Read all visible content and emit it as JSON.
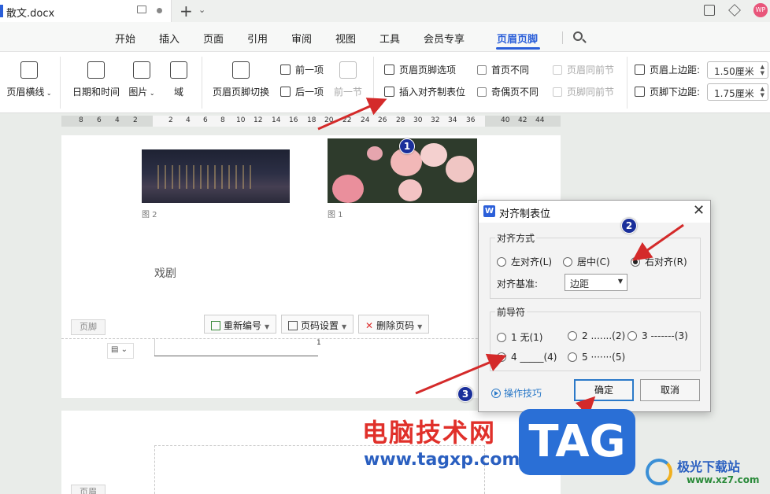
{
  "titlebar": {
    "doc_title": "散文.docx",
    "avatar_text": "WP"
  },
  "menu": {
    "items": [
      "开始",
      "插入",
      "页面",
      "引用",
      "审阅",
      "视图",
      "工具",
      "会员专享",
      "页眉页脚"
    ],
    "active": "页眉页脚"
  },
  "ribbon": {
    "header_line": "页眉横线",
    "date_time": "日期和时间",
    "picture": "图片",
    "field": "域",
    "switch_header_footer": "页眉页脚切换",
    "prev_item": "前一项",
    "next_item": "后一项",
    "prev_section": "前一节",
    "hf_options": "页眉页脚选项",
    "insert_tab": "插入对齐制表位",
    "first_diff": "首页不同",
    "odd_even_diff": "奇偶页不同",
    "header_same_prev": "页眉同前节",
    "footer_same_prev": "页脚同前节",
    "header_margin_label": "页眉上边距:",
    "header_margin_value": "1.50厘米",
    "footer_margin_label": "页脚下边距:",
    "footer_margin_value": "1.75厘米"
  },
  "ruler": {
    "ticks": [
      "8",
      "6",
      "4",
      "2",
      "2",
      "4",
      "6",
      "8",
      "10",
      "12",
      "14",
      "16",
      "18",
      "20",
      "22",
      "24",
      "26",
      "28",
      "30",
      "32",
      "34",
      "36",
      "40",
      "42",
      "44"
    ]
  },
  "document": {
    "caption_left": "图 2",
    "caption_right": "图 1",
    "body_text": "戏剧",
    "footer_tag": "页脚",
    "renumber_btn": "重新编号",
    "page_setting_btn": "页码设置",
    "delete_page_num_btn": "删除页码",
    "page_number": "1",
    "page2_footer_tag": "页眉"
  },
  "dialog": {
    "title": "对齐制表位",
    "align_group": "对齐方式",
    "align_left": "左对齐(L)",
    "align_center": "居中(C)",
    "align_right": "右对齐(R)",
    "align_base_label": "对齐基准:",
    "align_base_value": "边距",
    "leader_group": "前导符",
    "leader_1": "1 无(1)",
    "leader_2": "2 .......(2)",
    "leader_3": "3 -------(3)",
    "leader_4": "4 _____(4)",
    "leader_5": "5 ·······(5)",
    "tips": "操作技巧",
    "ok": "确定",
    "cancel": "取消"
  },
  "markers": [
    "1",
    "2",
    "3"
  ],
  "watermark": {
    "cn_text": "电脑技术网",
    "url": "www.tagxp.com",
    "tag": "TAG",
    "brand": "极光下载站",
    "brand_url": "www.xz7.com"
  },
  "colors": {
    "accent": "#2b5fd9",
    "arrow": "#d42a2a",
    "marker": "#1a2f9a"
  }
}
